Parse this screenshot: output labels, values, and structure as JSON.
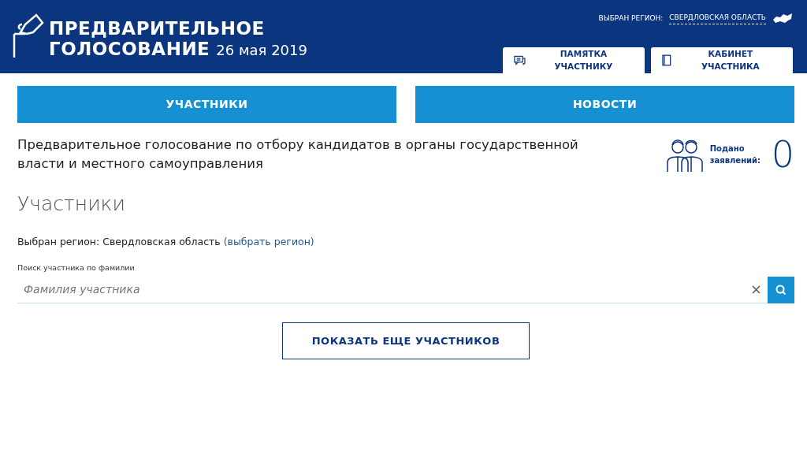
{
  "header": {
    "title_line_1": "ПРЕДВАРИТЕЛЬНОЕ",
    "title_line_2": "ГОЛОСОВАНИЕ",
    "date": "26 мая 2019",
    "region_label": "ВЫБРАН РЕГИОН:",
    "region_link": "СВЕРДЛОВСКАЯ ОБЛАСТЬ",
    "tabs": [
      {
        "label": "ПАМЯТКА УЧАСТНИКУ",
        "kind": "memo"
      },
      {
        "label": "КАБИНЕТ УЧАСТНИКА",
        "kind": "cabinet"
      }
    ]
  },
  "nav": [
    "УЧАСТНИКИ",
    "НОВОСТИ"
  ],
  "intro": "Предварительное голосование по отбору кандидатов в органы государственной власти и местного самоуправления",
  "stats": {
    "label": "Подано заявлений:",
    "count": "0"
  },
  "section_title": "Участники",
  "region": {
    "label": "Выбран регион: Свердловская область",
    "link": "(выбрать регион)"
  },
  "search": {
    "label": "Поиск участника по фамилии",
    "placeholder": "Фамилия участника"
  },
  "more_button": "ПОКАЗАТЬ ЕЩЕ УЧАСТНИКОВ"
}
